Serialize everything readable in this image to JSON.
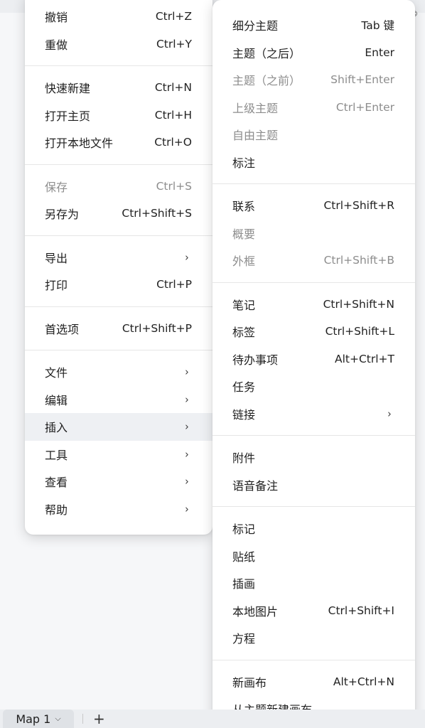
{
  "main_menu": {
    "groups": [
      [
        {
          "label": "撤销",
          "shortcut": "Ctrl+Z"
        },
        {
          "label": "重做",
          "shortcut": "Ctrl+Y"
        }
      ],
      [
        {
          "label": "快速新建",
          "shortcut": "Ctrl+N"
        },
        {
          "label": "打开主页",
          "shortcut": "Ctrl+H"
        },
        {
          "label": "打开本地文件",
          "shortcut": "Ctrl+O"
        }
      ],
      [
        {
          "label": "保存",
          "shortcut": "Ctrl+S"
        },
        {
          "label": "另存为",
          "shortcut": "Ctrl+Shift+S"
        }
      ],
      [
        {
          "label": "导出",
          "shortcut": "›"
        },
        {
          "label": "打印",
          "shortcut": "Ctrl+P"
        }
      ],
      [
        {
          "label": "首选项",
          "shortcut": "Ctrl+Shift+P"
        }
      ],
      [
        {
          "label": "文件",
          "shortcut": "›"
        },
        {
          "label": "编辑",
          "shortcut": "›"
        },
        {
          "label": "插入",
          "shortcut": "›"
        },
        {
          "label": "工具",
          "shortcut": "›"
        },
        {
          "label": "查看",
          "shortcut": "›"
        },
        {
          "label": "帮助",
          "shortcut": "›"
        }
      ]
    ]
  },
  "insert_menu": {
    "groups": [
      [
        {
          "label": "细分主题",
          "shortcut": "Tab 键"
        },
        {
          "label": "主题（之后）",
          "shortcut": "Enter"
        },
        {
          "label": "主题（之前）",
          "shortcut": "Shift+Enter"
        },
        {
          "label": "上级主题",
          "shortcut": "Ctrl+Enter"
        },
        {
          "label": "自由主题",
          "shortcut": ""
        },
        {
          "label": "标注",
          "shortcut": ""
        }
      ],
      [
        {
          "label": "联系",
          "shortcut": "Ctrl+Shift+R"
        },
        {
          "label": "概要",
          "shortcut": ""
        },
        {
          "label": "外框",
          "shortcut": "Ctrl+Shift+B"
        }
      ],
      [
        {
          "label": "笔记",
          "shortcut": "Ctrl+Shift+N"
        },
        {
          "label": "标签",
          "shortcut": "Ctrl+Shift+L"
        },
        {
          "label": "待办事项",
          "shortcut": "Alt+Ctrl+T"
        },
        {
          "label": "任务",
          "shortcut": ""
        },
        {
          "label": "链接",
          "shortcut": "›"
        }
      ],
      [
        {
          "label": "附件",
          "shortcut": ""
        },
        {
          "label": "语音备注",
          "shortcut": ""
        }
      ],
      [
        {
          "label": "标记",
          "shortcut": ""
        },
        {
          "label": "贴纸",
          "shortcut": ""
        },
        {
          "label": "插画",
          "shortcut": ""
        },
        {
          "label": "本地图片",
          "shortcut": "Ctrl+Shift+I"
        },
        {
          "label": "方程",
          "shortcut": ""
        }
      ],
      [
        {
          "label": "新画布",
          "shortcut": "Alt+Ctrl+N"
        },
        {
          "label": "从主题新建画布",
          "shortcut": ""
        }
      ]
    ]
  },
  "tab_bar": {
    "map_tab_label": "Map 1",
    "tab_chevron": "⌵",
    "add_glyph": "+"
  },
  "corner": {
    "glyph": "⊗"
  }
}
